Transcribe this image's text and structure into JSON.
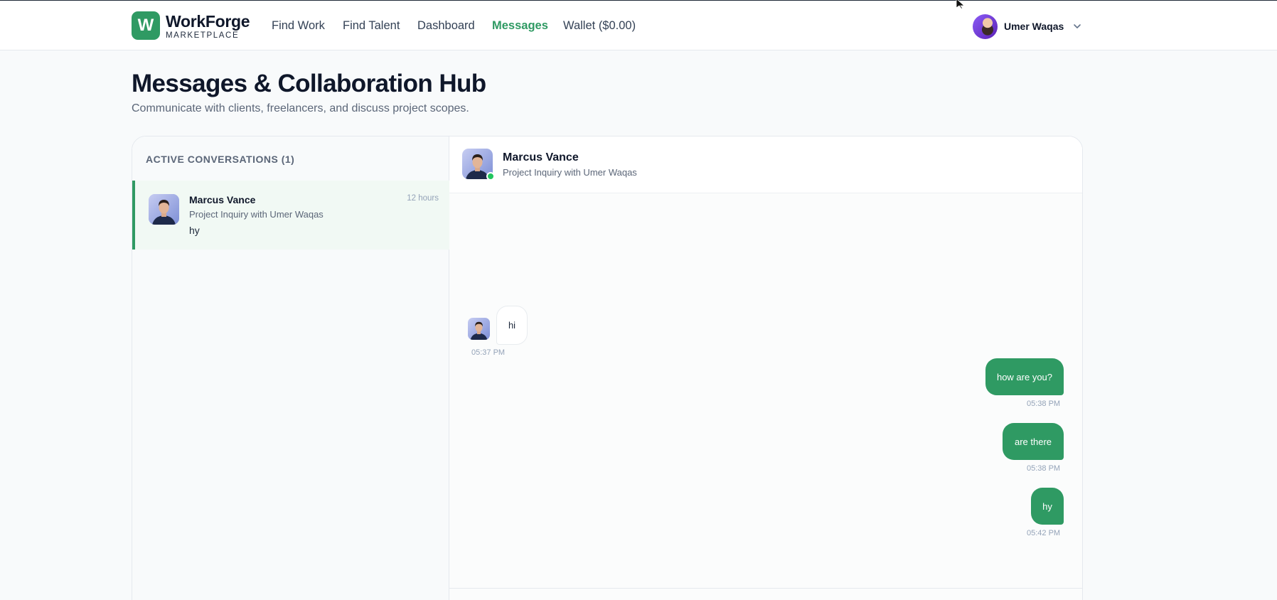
{
  "brand": {
    "logo_letter": "W",
    "name": "WorkForge",
    "tagline": "MARKETPLACE",
    "accent": "#2f9a63"
  },
  "nav": {
    "items": [
      {
        "label": "Find Work",
        "active": false
      },
      {
        "label": "Find Talent",
        "active": false
      },
      {
        "label": "Dashboard",
        "active": false
      },
      {
        "label": "Messages",
        "active": true
      },
      {
        "label": "Wallet ($0.00)",
        "active": false
      }
    ]
  },
  "user": {
    "name": "Umer Waqas"
  },
  "page": {
    "title": "Messages & Collaboration Hub",
    "subtitle": "Communicate with clients, freelancers, and discuss project scopes."
  },
  "sidebar": {
    "heading": "ACTIVE CONVERSATIONS (1)",
    "conversations": [
      {
        "name": "Marcus Vance",
        "subject": "Project Inquiry with Umer Waqas",
        "preview": "hy",
        "time": "12 hours",
        "selected": true
      }
    ]
  },
  "chat": {
    "contact_name": "Marcus Vance",
    "contact_subtitle": "Project Inquiry with Umer Waqas",
    "online": true,
    "messages": [
      {
        "direction": "in",
        "text": "hi",
        "time": "05:37 PM"
      },
      {
        "direction": "out",
        "text": "how are you?",
        "time": "05:38 PM"
      },
      {
        "direction": "out",
        "text": "are there",
        "time": "05:38 PM"
      },
      {
        "direction": "out",
        "text": "hy",
        "time": "05:42 PM"
      }
    ]
  }
}
